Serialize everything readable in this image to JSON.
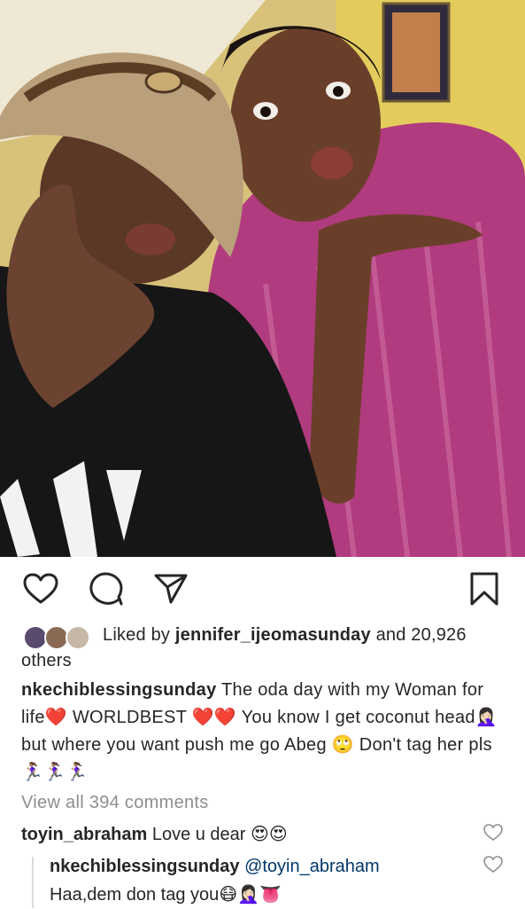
{
  "post": {
    "photo_icon": "selfie-photo",
    "liked_prefix": "Liked by ",
    "liked_user": "jennifer_ijeomasunday",
    "liked_suffix": " and 20,926 others",
    "caption_user": "nkechiblessingsunday",
    "caption_text": " The oda day with my Woman for life❤️ WORLDBEST ❤️❤️ You know I get coconut head🤦🏻‍♀️ but where you want push me go Abeg 🙄 Don't tag her pls 🏃🏽‍♀️🏃🏽‍♀️🏃🏽‍♀️",
    "view_all": "View all 394 comments"
  },
  "comments": [
    {
      "user": "toyin_abraham",
      "text": " Love u dear 😍😍"
    }
  ],
  "reply": {
    "user": "nkechiblessingsunday",
    "mention": " @toyin_abraham",
    "text": "Haa,dem don tag you😷🤦🏻‍♀️👅"
  },
  "icons": {
    "like": "heart-icon",
    "comment": "comment-icon",
    "share": "send-icon",
    "save": "bookmark-icon"
  },
  "colors": {
    "text": "#262626",
    "muted": "#8e8e8e",
    "link": "#00376b"
  }
}
